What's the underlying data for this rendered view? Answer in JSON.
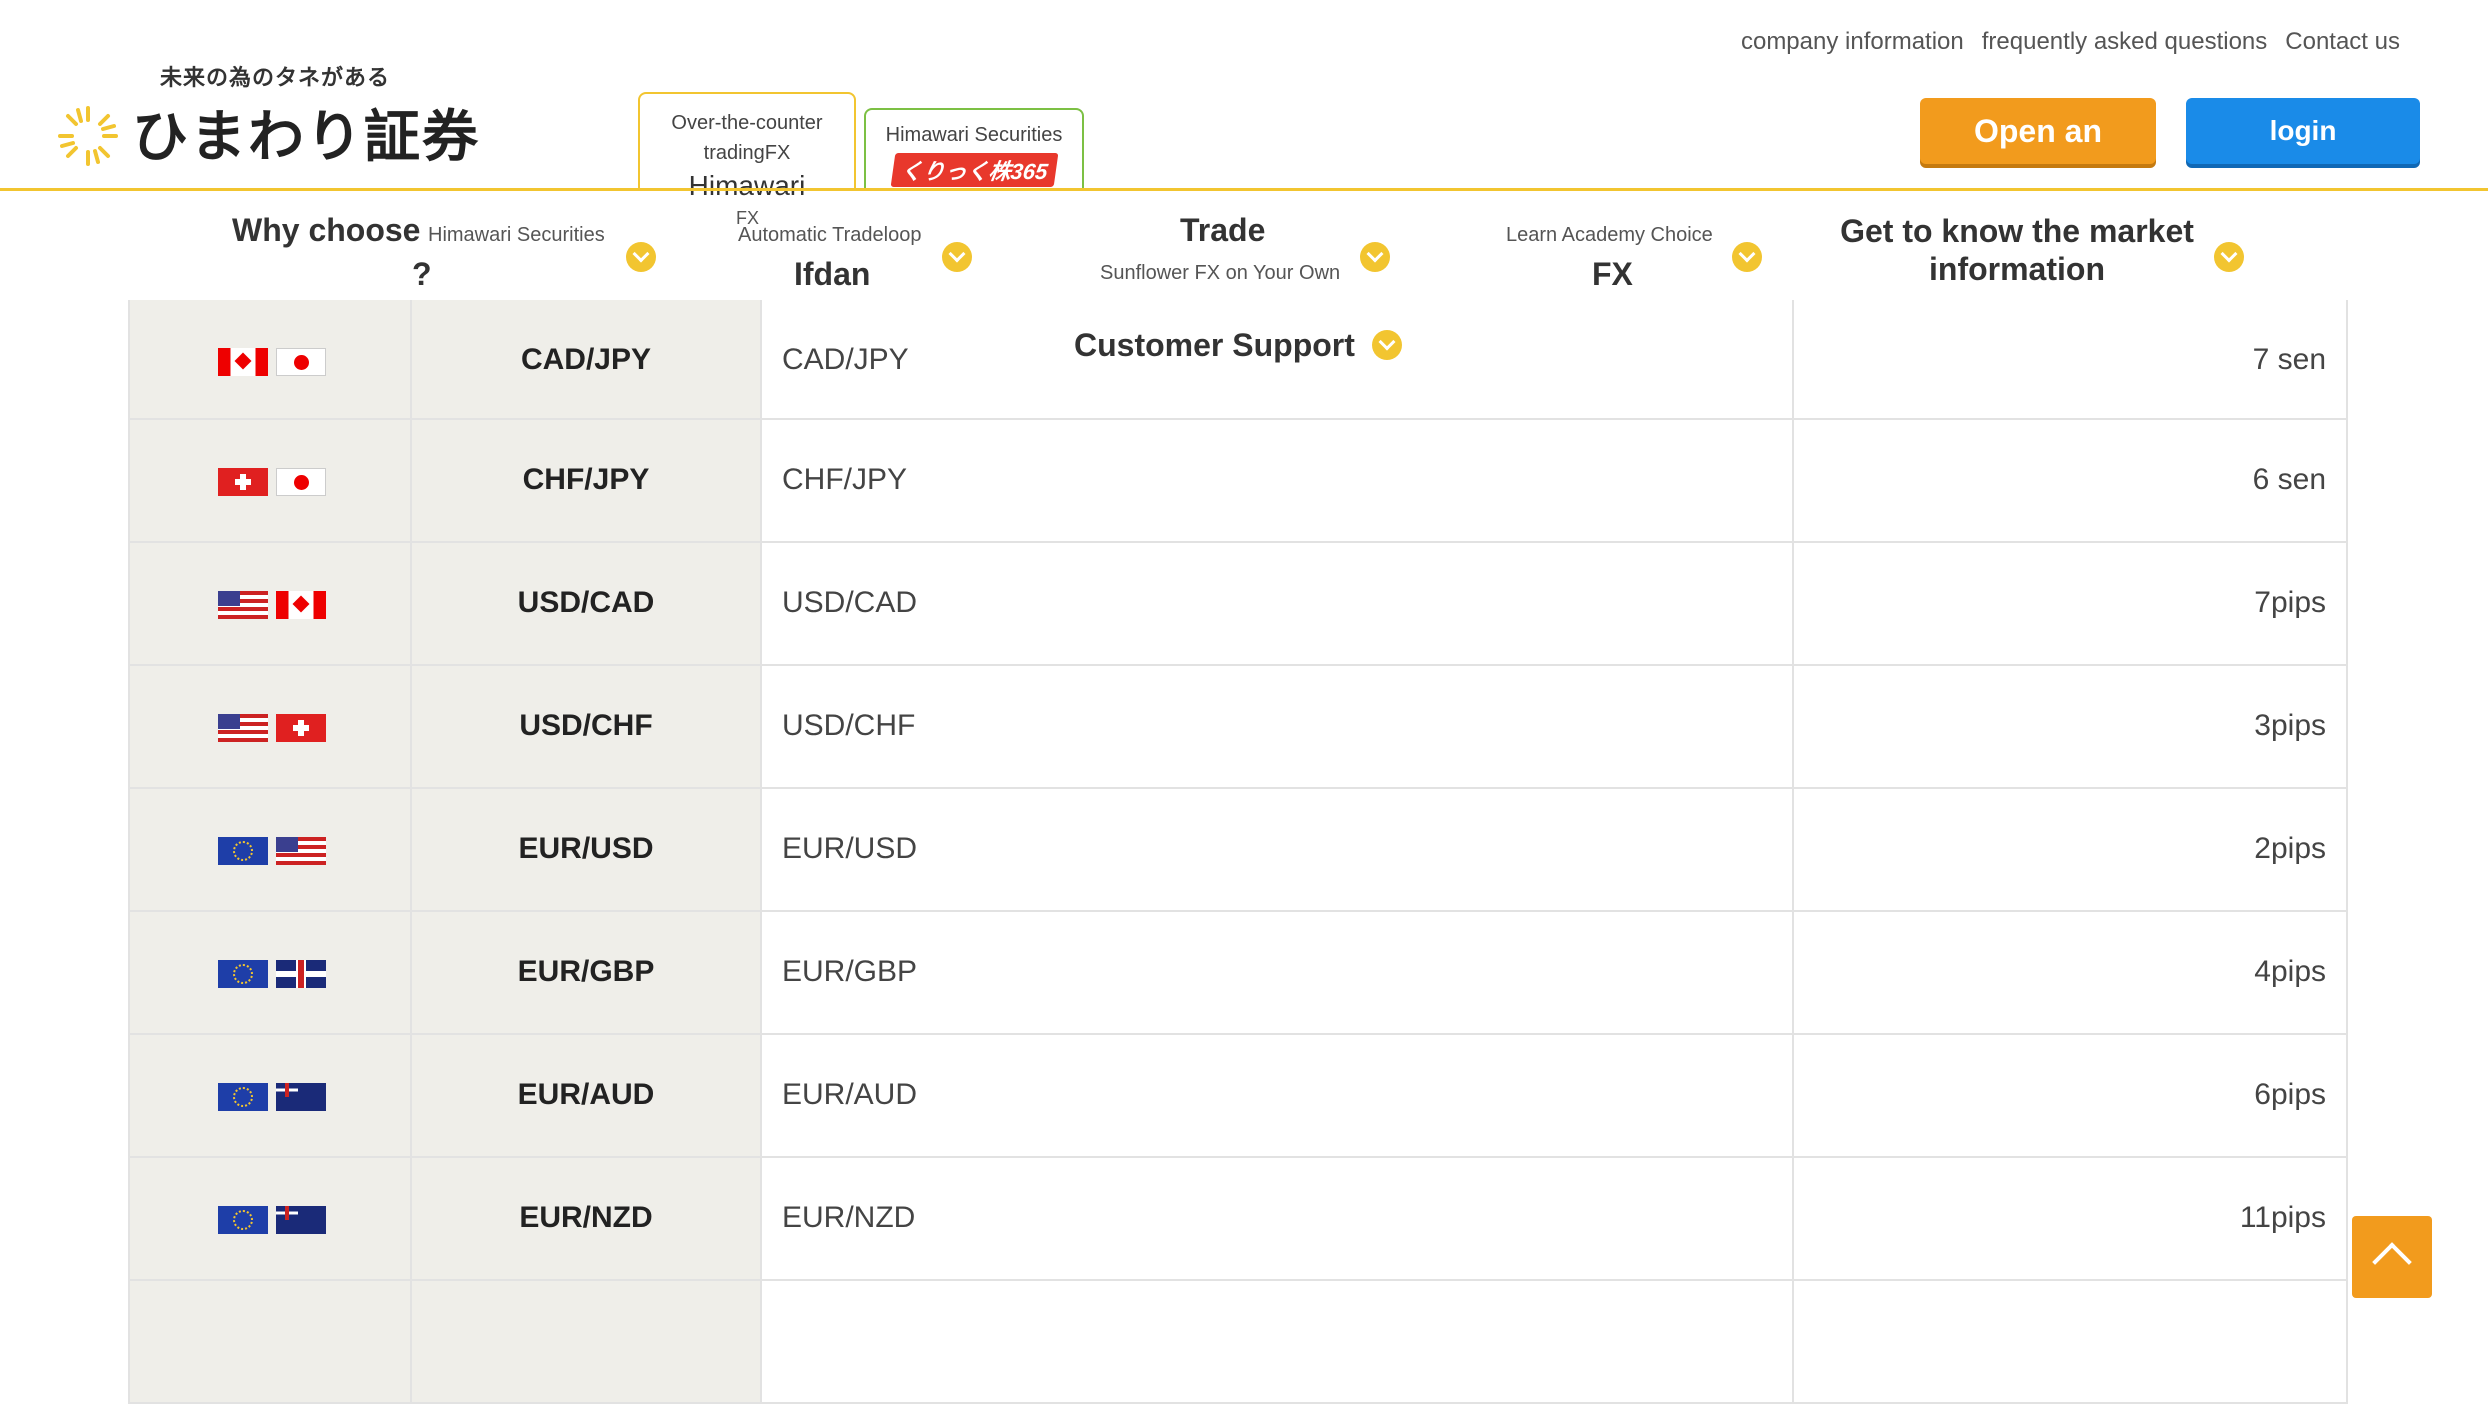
{
  "brand": {
    "tagline": "未来の為のタネがある",
    "name": "ひまわり証券"
  },
  "util_nav": [
    "company information",
    "frequently asked questions",
    "Contact us"
  ],
  "product_tabs": {
    "tab1_small": "Over-the-counter tradingFX",
    "tab1_big": "Himawari",
    "tab1_sub": "FX",
    "tab2_small": "Himawari Securities",
    "tab2_badge": "くりっく株365"
  },
  "buttons": {
    "open": "Open an",
    "login": "login"
  },
  "global_nav": {
    "why_big": "Why choose",
    "why_small": "Himawari Securities",
    "why_q": "?",
    "auto_small": "Automatic Tradeloop",
    "auto_big": "Ifdan",
    "trade_big": "Trade",
    "trade_small": "Sunflower FX on Your Own",
    "learn_small": "Learn Academy Choice",
    "learn_big": "FX",
    "market_big": "Get to know the market information",
    "support_big": "Customer Support"
  },
  "rows": [
    {
      "flags": [
        "CA",
        "JP"
      ],
      "pair": "CAD/JPY",
      "name": "CAD/JPY",
      "spread": "7 sen"
    },
    {
      "flags": [
        "CH",
        "JP"
      ],
      "pair": "CHF/JPY",
      "name": "CHF/JPY",
      "spread": "6 sen"
    },
    {
      "flags": [
        "US",
        "CA"
      ],
      "pair": "USD/CAD",
      "name": "USD/CAD",
      "spread": "7pips"
    },
    {
      "flags": [
        "US",
        "CH"
      ],
      "pair": "USD/CHF",
      "name": "USD/CHF",
      "spread": "3pips"
    },
    {
      "flags": [
        "EU",
        "US"
      ],
      "pair": "EUR/USD",
      "name": "EUR/USD",
      "spread": "2pips"
    },
    {
      "flags": [
        "EU",
        "GB"
      ],
      "pair": "EUR/GBP",
      "name": "EUR/GBP",
      "spread": "4pips"
    },
    {
      "flags": [
        "EU",
        "AU"
      ],
      "pair": "EUR/AUD",
      "name": "EUR/AUD",
      "spread": "6pips"
    },
    {
      "flags": [
        "EU",
        "NZ"
      ],
      "pair": "EUR/NZD",
      "name": "EUR/NZD",
      "spread": "11pips"
    },
    {
      "flags": [],
      "pair": "",
      "name": "",
      "spread": ""
    }
  ],
  "colors": {
    "accent_yellow": "#f2c530",
    "open_orange": "#f29b1d",
    "login_blue": "#1a8be8",
    "kabu_red": "#e8382c"
  },
  "icons": {
    "nav_chevron": "chevron-down-icon",
    "back_to_top": "arrow-up-icon",
    "logo": "sunflower-logo-icon"
  }
}
